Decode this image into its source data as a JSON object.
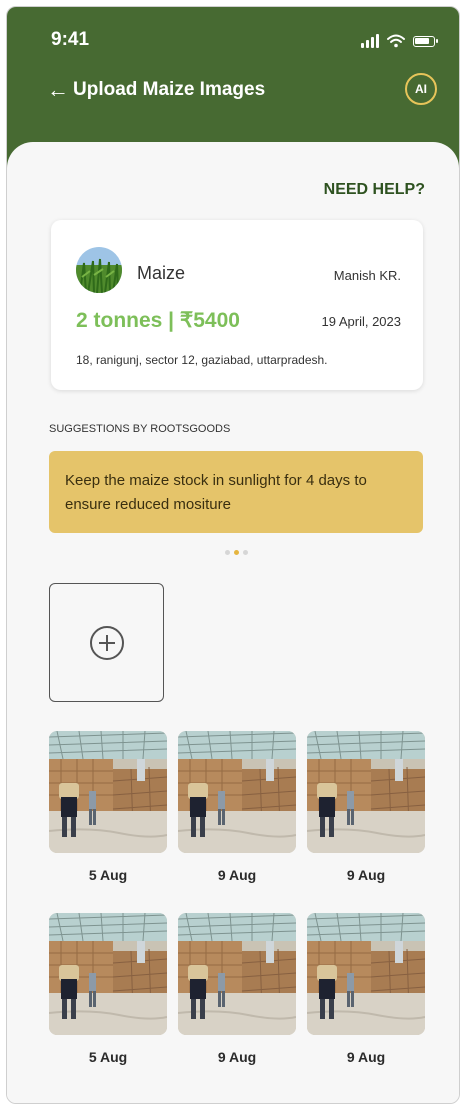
{
  "status_bar": {
    "time": "9:41"
  },
  "topbar": {
    "title": "Upload Maize Images",
    "back_icon": "arrow-left-icon",
    "ai_label": "AI"
  },
  "help": {
    "label": "NEED HELP?"
  },
  "crop_card": {
    "crop_name": "Maize",
    "farmer": "Manish KR.",
    "quantity": "2 tonnes | ₹5400",
    "date": "19 April, 2023",
    "address": "18, ranigunj, sector 12, gaziabad, uttarpradesh."
  },
  "suggestions": {
    "label": "SUGGESTIONS BY ROOTSGOODS",
    "text": "Keep the maize stock in sunlight for 4 days to ensure reduced mositure"
  },
  "carousel": {
    "total": 3,
    "active_index": 1
  },
  "images": [
    {
      "date": "5 Aug"
    },
    {
      "date": "9 Aug"
    },
    {
      "date": "9 Aug"
    },
    {
      "date": "5 Aug"
    },
    {
      "date": "9 Aug"
    },
    {
      "date": "9 Aug"
    }
  ],
  "colors": {
    "header": "#476a32",
    "accent_gold": "#e5c46a",
    "quantity_green": "#7dbf59",
    "help_green": "#2e5220"
  }
}
